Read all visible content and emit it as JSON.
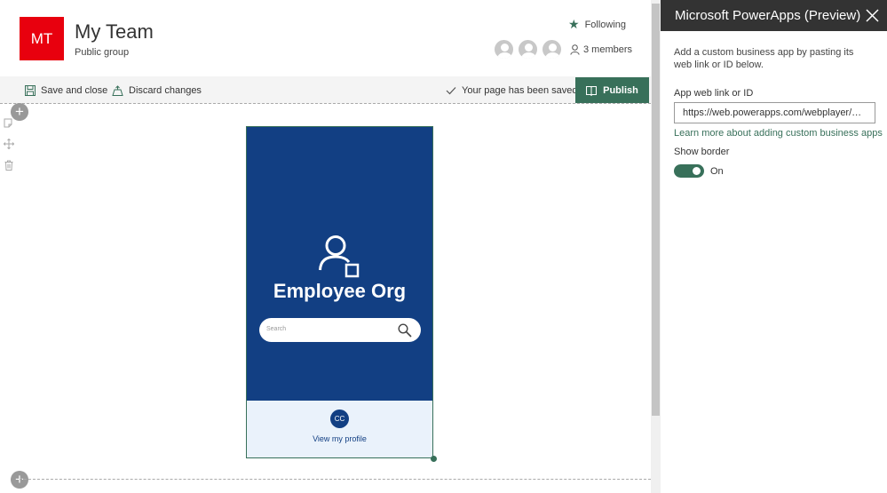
{
  "site": {
    "logo_initials": "MT",
    "title": "My Team",
    "subtitle": "Public group",
    "follow_label": "Following",
    "members_label": "3 members"
  },
  "commandbar": {
    "save_close_label": "Save and close",
    "discard_label": "Discard changes",
    "saved_status": "Your page has been saved",
    "publish_label": "Publish"
  },
  "app": {
    "title": "Employee Org",
    "search_placeholder": "Search",
    "profile_initials": "CC",
    "profile_link": "View my profile"
  },
  "panel": {
    "title": "Microsoft PowerApps (Preview)",
    "description": "Add a custom business app by pasting its web link or ID below.",
    "field_label": "App web link or ID",
    "field_value": "https://web.powerapps.com/webplayer/app?...",
    "learn_more": "Learn more about adding custom business apps",
    "toggle_label": "Show border",
    "toggle_state": "On"
  },
  "colors": {
    "brand_red": "#e8000e",
    "accent_green": "#38705a",
    "app_blue": "#123f83",
    "panel_header": "#333333"
  },
  "icons": [
    "star-icon",
    "person-icon",
    "save-icon",
    "discard-icon",
    "checkmark-icon",
    "publish-icon",
    "edit-icon",
    "move-icon",
    "delete-icon",
    "add-icon",
    "app-user-icon",
    "search-icon",
    "close-icon"
  ]
}
